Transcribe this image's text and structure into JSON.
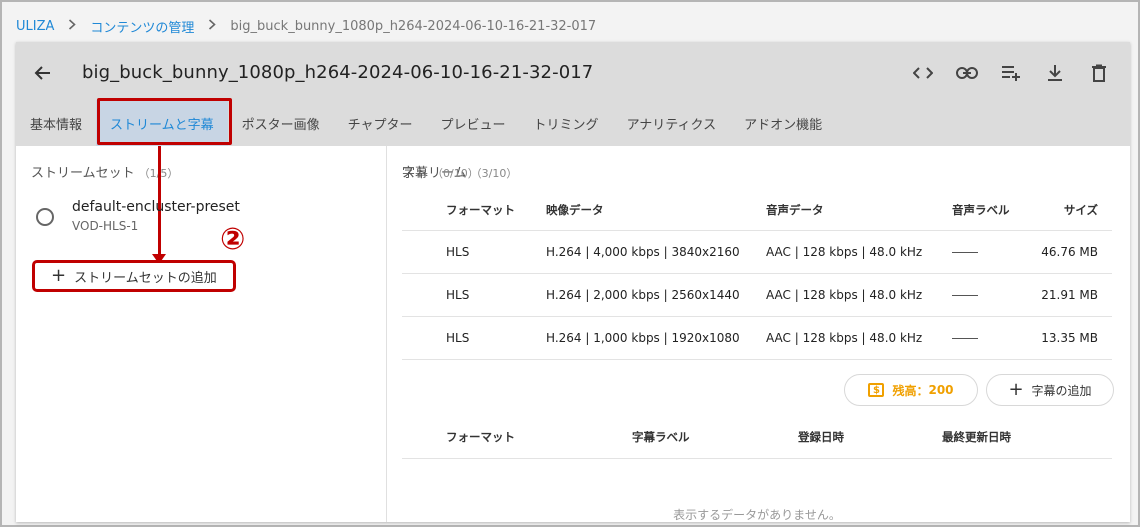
{
  "breadcrumb": {
    "root": "ULIZA",
    "section": "コンテンツの管理",
    "current": "big_buck_bunny_1080p_h264-2024-06-10-16-21-32-017"
  },
  "header": {
    "title": "big_buck_bunny_1080p_h264-2024-06-10-16-21-32-017",
    "actions": [
      "code-icon",
      "link-icon",
      "playlist-add-icon",
      "download-icon",
      "trash-icon"
    ]
  },
  "tabs": [
    {
      "label": "基本情報"
    },
    {
      "label": "ストリームと字幕",
      "active": true
    },
    {
      "label": "ポスター画像"
    },
    {
      "label": "チャプター"
    },
    {
      "label": "プレビュー"
    },
    {
      "label": "トリミング"
    },
    {
      "label": "アナリティクス"
    },
    {
      "label": "アドオン機能"
    }
  ],
  "stream_sets": {
    "title": "ストリームセット",
    "count": "（1/5）",
    "items": [
      {
        "name": "default-encluster-preset",
        "sub": "VOD-HLS-1"
      }
    ],
    "add_label": "ストリームセットの追加",
    "annotation": "②"
  },
  "streams": {
    "title": "ストリーム",
    "count": "（3/10）",
    "columns": [
      "フォーマット",
      "映像データ",
      "音声データ",
      "音声ラベル",
      "サイズ"
    ],
    "rows": [
      {
        "format": "HLS",
        "video": "H.264 | 4,000 kbps | 3840x2160",
        "audio": "AAC | 128 kbps | 48.0 kHz",
        "label": "",
        "size": "46.76 MB"
      },
      {
        "format": "HLS",
        "video": "H.264 | 2,000 kbps | 2560x1440",
        "audio": "AAC | 128 kbps | 48.0 kHz",
        "label": "",
        "size": "21.91 MB"
      },
      {
        "format": "HLS",
        "video": "H.264 | 1,000 kbps | 1920x1080",
        "audio": "AAC | 128 kbps | 48.0 kHz",
        "label": "",
        "size": "13.35 MB"
      }
    ]
  },
  "subtitles": {
    "title": "字幕",
    "count": "（0/10）",
    "balance_label": "残高：",
    "balance_value": "200",
    "add_label": "字幕の追加",
    "columns": [
      "フォーマット",
      "字幕ラベル",
      "登録日時",
      "最終更新日時"
    ],
    "empty_text": "表示するデータがありません。"
  },
  "colors": {
    "accent": "#1f88d6",
    "annotation": "#c00000",
    "balance": "#f0a000",
    "header_bg": "#dcdcdc",
    "active_tab_bg": "#c8d5e4"
  }
}
